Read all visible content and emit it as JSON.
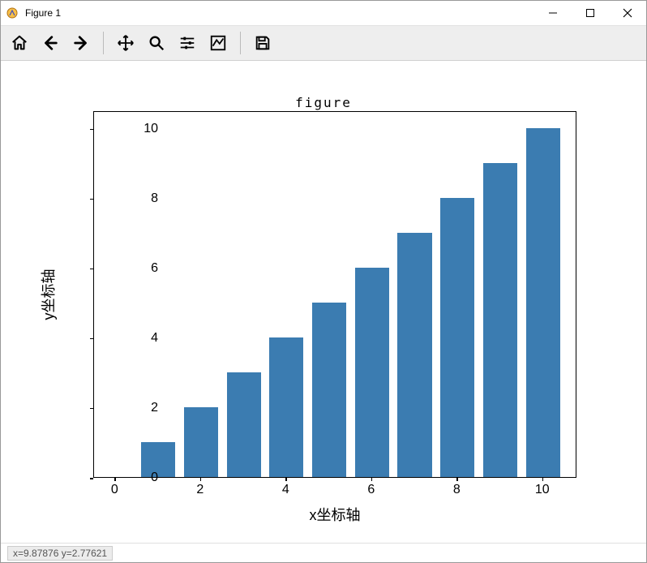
{
  "window": {
    "title": "Figure 1"
  },
  "toolbar": {
    "home": "Home",
    "back": "Back",
    "forward": "Forward",
    "pan": "Pan",
    "zoom": "Zoom",
    "configure": "Configure subplots",
    "edit": "Edit axis",
    "save": "Save"
  },
  "chart_data": {
    "type": "bar",
    "title": "figure",
    "xlabel": "x坐标轴",
    "ylabel": "y坐标轴",
    "categories": [
      1,
      2,
      3,
      4,
      5,
      6,
      7,
      8,
      9,
      10
    ],
    "values": [
      1,
      2,
      3,
      4,
      5,
      6,
      7,
      8,
      9,
      10
    ],
    "xlim": [
      -0.5,
      10.8
    ],
    "ylim": [
      0,
      10.5
    ],
    "xticks": [
      0,
      2,
      4,
      6,
      8,
      10
    ],
    "yticks": [
      0,
      2,
      4,
      6,
      8,
      10
    ],
    "bar_color": "#3b7cb1"
  },
  "status": {
    "coords": "x=9.87876    y=2.77621"
  }
}
